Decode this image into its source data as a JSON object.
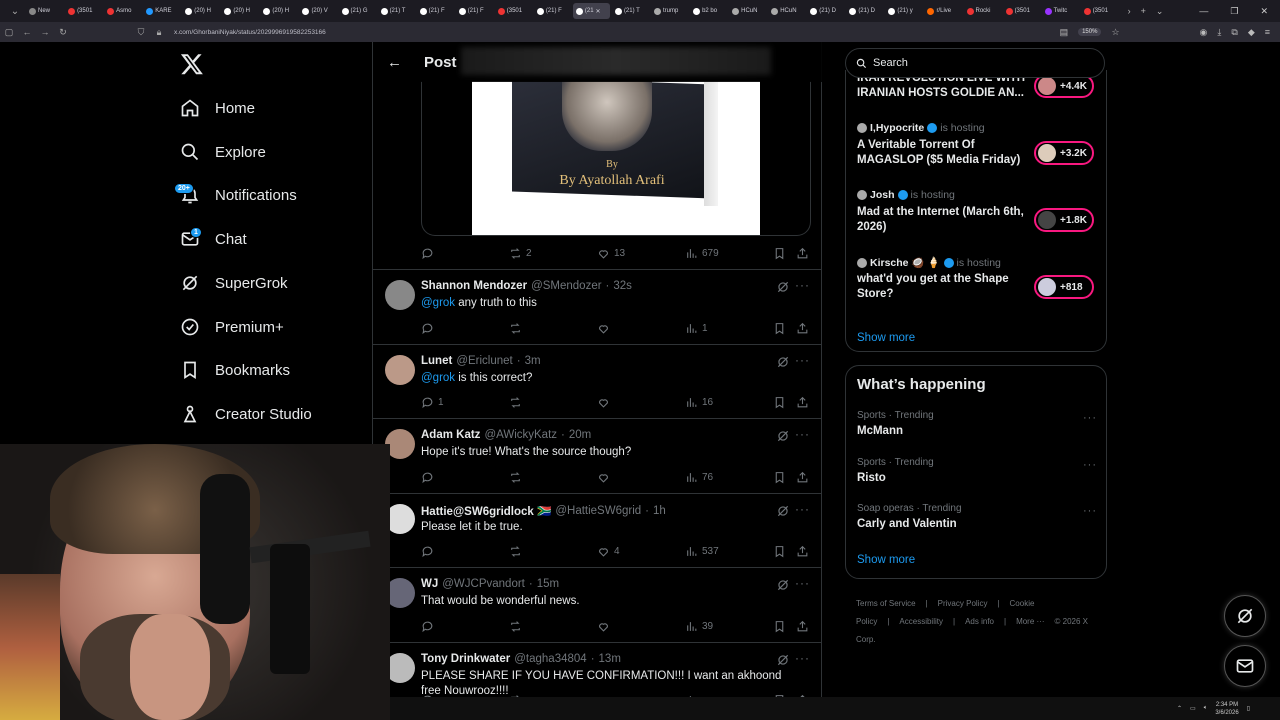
{
  "browser": {
    "tabs": [
      {
        "label": "New",
        "color": "#888"
      },
      {
        "label": "(3501",
        "color": "#e33"
      },
      {
        "label": "Asmo",
        "color": "#e33"
      },
      {
        "label": "KARE",
        "color": "#29f"
      },
      {
        "label": "(20) H",
        "color": "#fff"
      },
      {
        "label": "(20) H",
        "color": "#fff"
      },
      {
        "label": "(20) H",
        "color": "#fff"
      },
      {
        "label": "(20) V",
        "color": "#fff"
      },
      {
        "label": "(21) G",
        "color": "#fff"
      },
      {
        "label": "(21) T",
        "color": "#fff"
      },
      {
        "label": "(21) F",
        "color": "#fff"
      },
      {
        "label": "(21) F",
        "color": "#fff"
      },
      {
        "label": "(3501",
        "color": "#e33"
      },
      {
        "label": "(21) F",
        "color": "#fff"
      },
      {
        "label": "(21",
        "color": "#fff"
      },
      {
        "label": "(21) T",
        "color": "#fff"
      },
      {
        "label": "trump",
        "color": "#aaa"
      },
      {
        "label": "b2 bo",
        "color": "#fff"
      },
      {
        "label": "HCuN",
        "color": "#aaa"
      },
      {
        "label": "HCuN",
        "color": "#aaa"
      },
      {
        "label": "(21) D",
        "color": "#fff"
      },
      {
        "label": "(21) D",
        "color": "#fff"
      },
      {
        "label": "(21) y",
        "color": "#fff"
      },
      {
        "label": "r/Live",
        "color": "#f60"
      },
      {
        "label": "Rocki",
        "color": "#e33"
      },
      {
        "label": "(3501",
        "color": "#e33"
      },
      {
        "label": "Twitc",
        "color": "#93f"
      },
      {
        "label": "(3501",
        "color": "#e33"
      }
    ],
    "active_tab_index": 14,
    "url": "x.com/GhorbaniNiyak/status/2029996919582253166",
    "zoom": "150%"
  },
  "nav": {
    "home": "Home",
    "explore": "Explore",
    "notifications": "Notifications",
    "notifications_badge": "20+",
    "chat": "Chat",
    "chat_badge": "1",
    "supergrok": "SuperGrok",
    "premium": "Premium+",
    "bookmarks": "Bookmarks",
    "creator_studio": "Creator Studio"
  },
  "post": {
    "header_title": "Post",
    "image_by": "By",
    "image_author": "By Ayatollah Arafi",
    "stats": {
      "replies": "",
      "reposts": "2",
      "likes": "13",
      "views": "679"
    }
  },
  "replies": [
    {
      "name": "Shannon Mendozer",
      "handle": "@SMendozer",
      "time": "32s",
      "mention": "@grok",
      "text": " any truth to this",
      "replies": "",
      "reposts": "",
      "likes": "",
      "views": "1",
      "avatar": "#888"
    },
    {
      "name": "Lunet",
      "handle": "@Ericlunet",
      "time": "3m",
      "mention": "@grok",
      "text": " is this correct?",
      "replies": "1",
      "reposts": "",
      "likes": "",
      "views": "16",
      "avatar": "#b98"
    },
    {
      "name": "Adam Katz",
      "handle": "@AWickyKatz",
      "time": "20m",
      "mention": "",
      "text": "Hope it's true! What's the source though?",
      "replies": "",
      "reposts": "",
      "likes": "",
      "views": "76",
      "avatar": "#a87"
    },
    {
      "name": "Hattie@SW6gridlock 🇿🇦",
      "handle": "@HattieSW6grid",
      "time": "1h",
      "mention": "",
      "text": "Please let it be true.",
      "replies": "",
      "reposts": "",
      "likes": "4",
      "views": "537",
      "avatar": "#ddd"
    },
    {
      "name": "WJ",
      "handle": "@WJCPvandort",
      "time": "15m",
      "mention": "",
      "text": "That would be wonderful news.",
      "replies": "",
      "reposts": "",
      "likes": "",
      "views": "39",
      "avatar": "#667"
    },
    {
      "name": "Tony Drinkwater",
      "handle": "@tagha34804",
      "time": "13m",
      "mention": "",
      "text": "PLEASE SHARE IF YOU HAVE CONFIRMATION!!! I want an akhoond free Nouwrooz!!!!",
      "replies": "",
      "reposts": "",
      "likes": "",
      "views": "",
      "avatar": "#bbb"
    }
  ],
  "search": {
    "placeholder": "Search"
  },
  "spaces": [
    {
      "host": "",
      "status": "",
      "title": "IRAN REVOLUTION LIVE WITH IRANIAN HOSTS GOLDIE AN...",
      "count": "+4.4K"
    },
    {
      "host": "I,Hypocrite",
      "status": "is hosting",
      "title": "A Veritable Torrent Of MAGASLOP ($5 Media Friday)",
      "count": "+3.2K"
    },
    {
      "host": "Josh",
      "status": "is hosting",
      "title": "Mad at the Internet (March 6th, 2026)",
      "count": "+1.8K"
    },
    {
      "host": "Kirsche 🥥 🍦",
      "status": "is hosting",
      "title": "what'd you get at the Shape Store?",
      "count": "+818"
    }
  ],
  "spaces_show_more": "Show more",
  "happening": {
    "title": "What’s happening",
    "trends": [
      {
        "category": "Sports · Trending",
        "name": "McMann"
      },
      {
        "category": "Sports · Trending",
        "name": "Risto"
      },
      {
        "category": "Soap operas · Trending",
        "name": "Carly and Valentin"
      }
    ],
    "show_more": "Show more"
  },
  "footer": {
    "links": [
      "Terms of Service",
      "|",
      "Privacy Policy",
      "|",
      "Cookie Policy",
      "|",
      "Accessibility",
      "|",
      "Ads info",
      "|",
      "More ···",
      "© 2026 X Corp."
    ]
  },
  "taskbar": {
    "time": "2:34 PM",
    "date": "3/6/2026"
  },
  "colors": {
    "accent": "#1d9bf0",
    "live": "#f91880",
    "border": "#2f3336",
    "muted": "#71767b"
  }
}
